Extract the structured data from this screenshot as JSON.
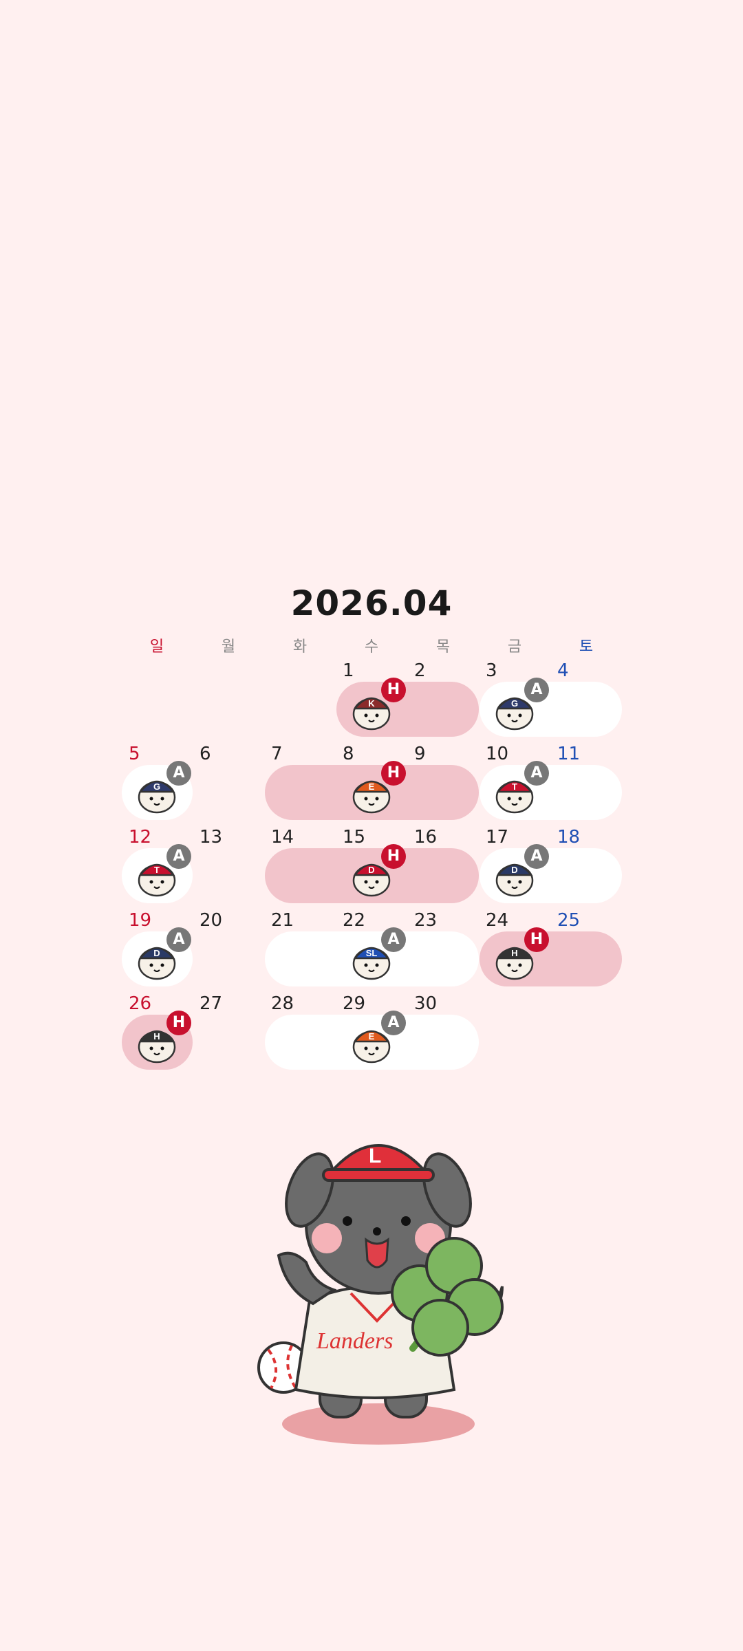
{
  "calendar": {
    "title": "2026.04",
    "weekdays": [
      "일",
      "월",
      "화",
      "수",
      "목",
      "금",
      "토"
    ],
    "days": [
      {
        "d": "1"
      },
      {
        "d": "2"
      },
      {
        "d": "3"
      },
      {
        "d": "4"
      },
      {
        "d": "5"
      },
      {
        "d": "6"
      },
      {
        "d": "7"
      },
      {
        "d": "8"
      },
      {
        "d": "9"
      },
      {
        "d": "10"
      },
      {
        "d": "11"
      },
      {
        "d": "12"
      },
      {
        "d": "13"
      },
      {
        "d": "14"
      },
      {
        "d": "15"
      },
      {
        "d": "16"
      },
      {
        "d": "17"
      },
      {
        "d": "18"
      },
      {
        "d": "19"
      },
      {
        "d": "20"
      },
      {
        "d": "21"
      },
      {
        "d": "22"
      },
      {
        "d": "23"
      },
      {
        "d": "24"
      },
      {
        "d": "25"
      },
      {
        "d": "26"
      },
      {
        "d": "27"
      },
      {
        "d": "28"
      },
      {
        "d": "29"
      },
      {
        "d": "30"
      }
    ],
    "series": [
      {
        "badge": "H",
        "cap": "K",
        "team_color": "#8b2b2b",
        "icon": "kt-mascot-icon"
      },
      {
        "badge": "A",
        "cap": "G",
        "team_color": "#2e3a6b",
        "icon": "giants-mascot-icon"
      },
      {
        "badge": "A",
        "cap": "G",
        "team_color": "#2e3a6b",
        "icon": "giants-mascot-icon"
      },
      {
        "badge": "H",
        "cap": "E",
        "team_color": "#e05a1e",
        "icon": "eagles-mascot-icon"
      },
      {
        "badge": "A",
        "cap": "T",
        "team_color": "#c8102e",
        "icon": "tigers-mascot-icon"
      },
      {
        "badge": "A",
        "cap": "T",
        "team_color": "#c8102e",
        "icon": "tigers-mascot-icon"
      },
      {
        "badge": "H",
        "cap": "D",
        "team_color": "#c8102e",
        "icon": "doosan-mascot-icon"
      },
      {
        "badge": "A",
        "cap": "D",
        "team_color": "#2a3a66",
        "icon": "dinos-mascot-icon"
      },
      {
        "badge": "A",
        "cap": "D",
        "team_color": "#2a3a66",
        "icon": "dinos-mascot-icon"
      },
      {
        "badge": "A",
        "cap": "SL",
        "team_color": "#1f4fb4",
        "icon": "lions-mascot-icon"
      },
      {
        "badge": "H",
        "cap": "H",
        "team_color": "#333333",
        "icon": "heroes-mascot-icon"
      },
      {
        "badge": "H",
        "cap": "H",
        "team_color": "#333333",
        "icon": "heroes-mascot-icon"
      },
      {
        "badge": "A",
        "cap": "E",
        "team_color": "#e05a1e",
        "icon": "eagles-mascot-icon"
      }
    ]
  },
  "hero": {
    "icon": "landers-mascot-icon",
    "cap_letter": "L",
    "jersey_text": "Landers"
  },
  "colors": {
    "home_pill": "#f2c4cb",
    "away_pill": "#ffffff",
    "sunday": "#c8102e",
    "saturday": "#1f4fb4",
    "badge_home": "#c8102e",
    "badge_away": "#777777"
  }
}
